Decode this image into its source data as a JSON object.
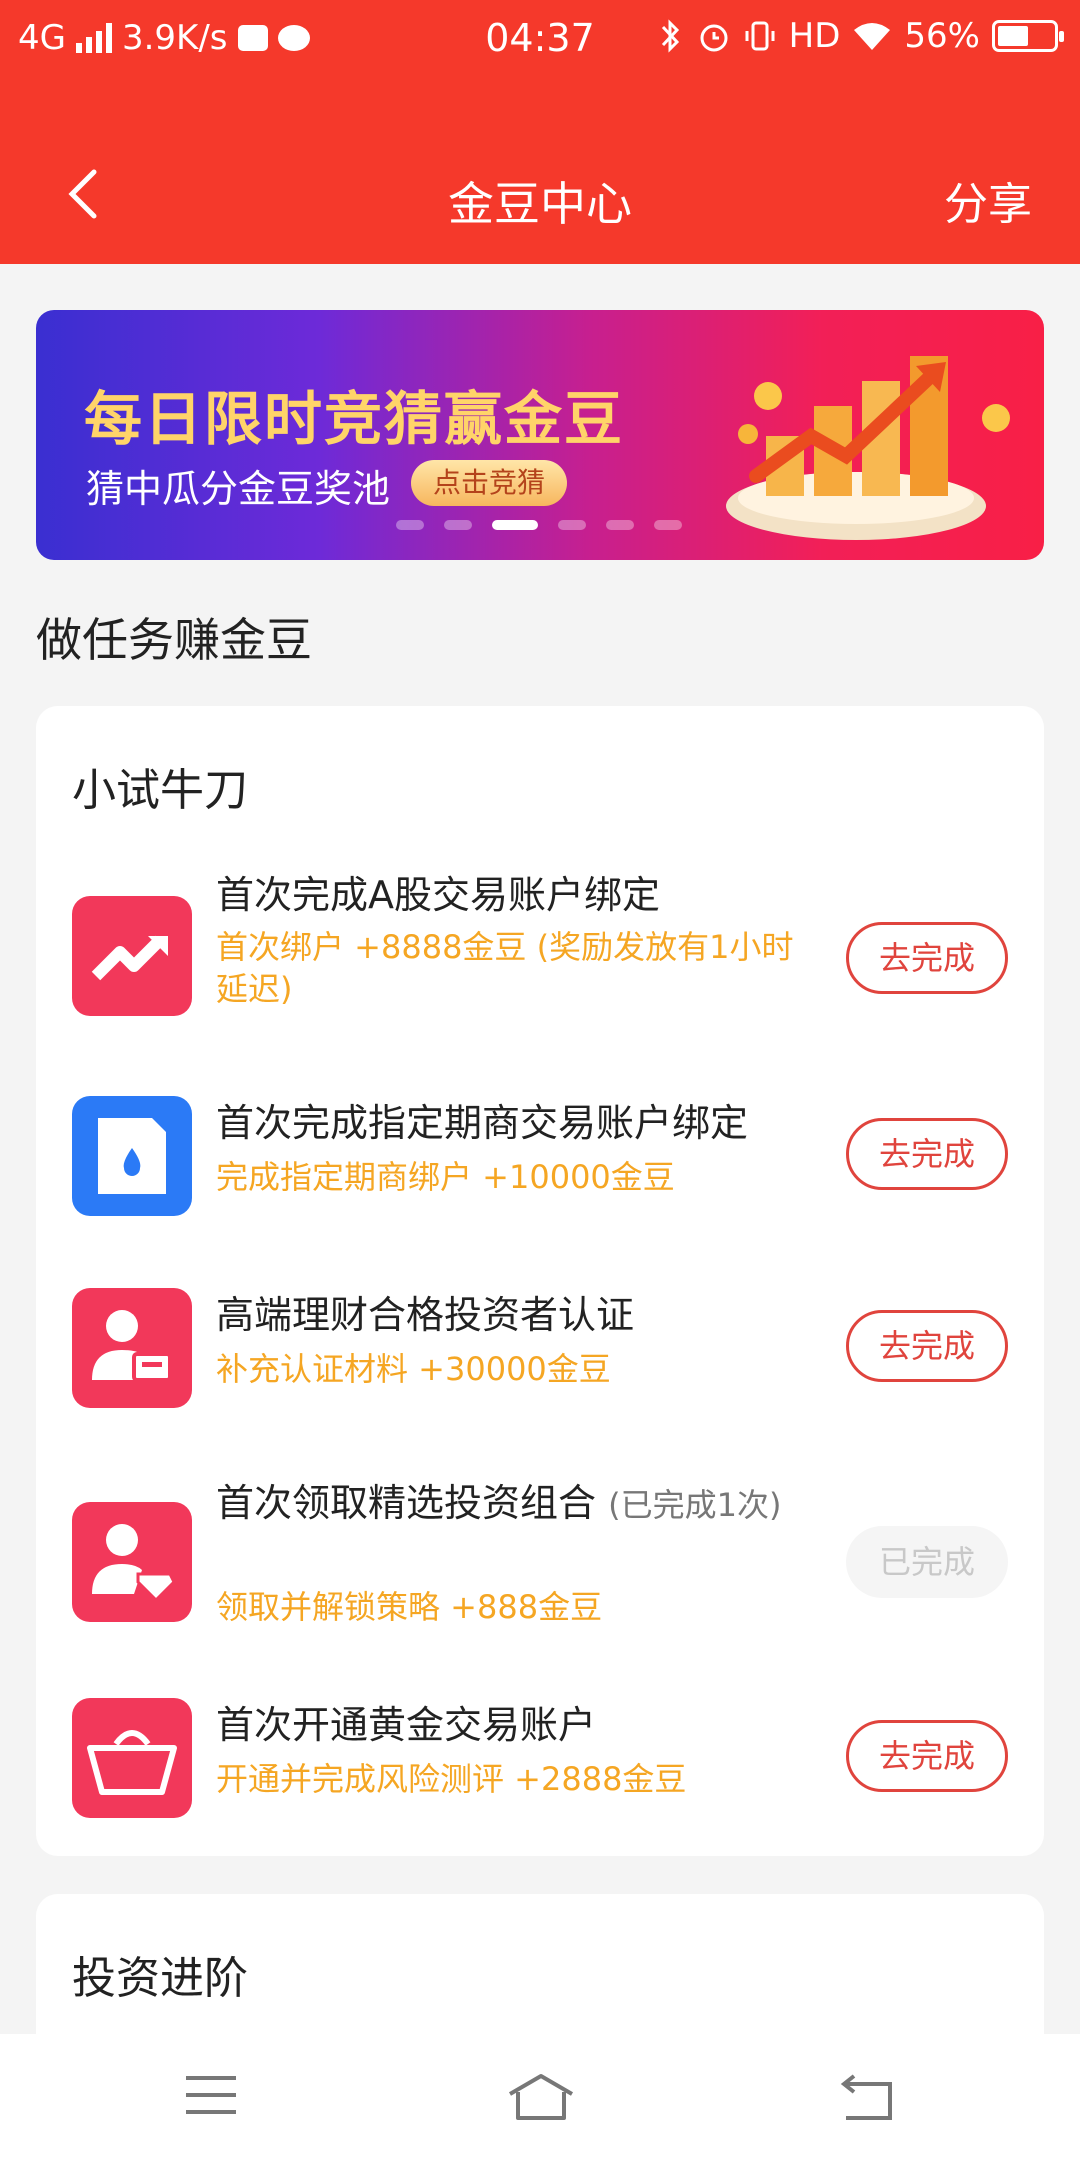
{
  "status_bar": {
    "network": "4G",
    "speed": "3.9K/s",
    "time": "04:37",
    "hd": "HD",
    "battery": "56%"
  },
  "nav": {
    "title": "金豆中心",
    "share_label": "分享",
    "back_icon": "chevron-left-icon"
  },
  "banner": {
    "headline": "每日限时竞猜赢金豆",
    "subtitle": "猜中瓜分金豆奖池",
    "cta": "点击竞猜",
    "slides": 6,
    "active_slide": 3
  },
  "section_title": "做任务赚金豆",
  "card1": {
    "title": "小试牛刀",
    "tasks": [
      {
        "icon": "trend-up-icon",
        "name": "首次完成A股交易账户绑定",
        "reward": "首次绑户 +8888金豆 (奖励发放有1小时延迟)",
        "button": "去完成"
      },
      {
        "icon": "document-drop-icon",
        "name": "首次完成指定期商交易账户绑定",
        "reward": "完成指定期商绑户 +10000金豆",
        "button": "去完成"
      },
      {
        "icon": "user-card-icon",
        "name": "高端理财合格投资者认证",
        "reward": "补充认证材料 +30000金豆",
        "button": "去完成"
      },
      {
        "icon": "user-diamond-icon",
        "name": "首次领取精选投资组合",
        "note": "(已完成1次)",
        "reward": "领取并解锁策略 +888金豆",
        "button": "已完成"
      },
      {
        "icon": "basket-icon",
        "name": "首次开通黄金交易账户",
        "reward": "开通并完成风险测评 +2888金豆",
        "button": "去完成"
      }
    ]
  },
  "card2": {
    "title": "投资进阶"
  },
  "colors": {
    "brand_red": "#f5392b",
    "reward_orange": "#f5a623",
    "button_red": "#e0443d"
  }
}
